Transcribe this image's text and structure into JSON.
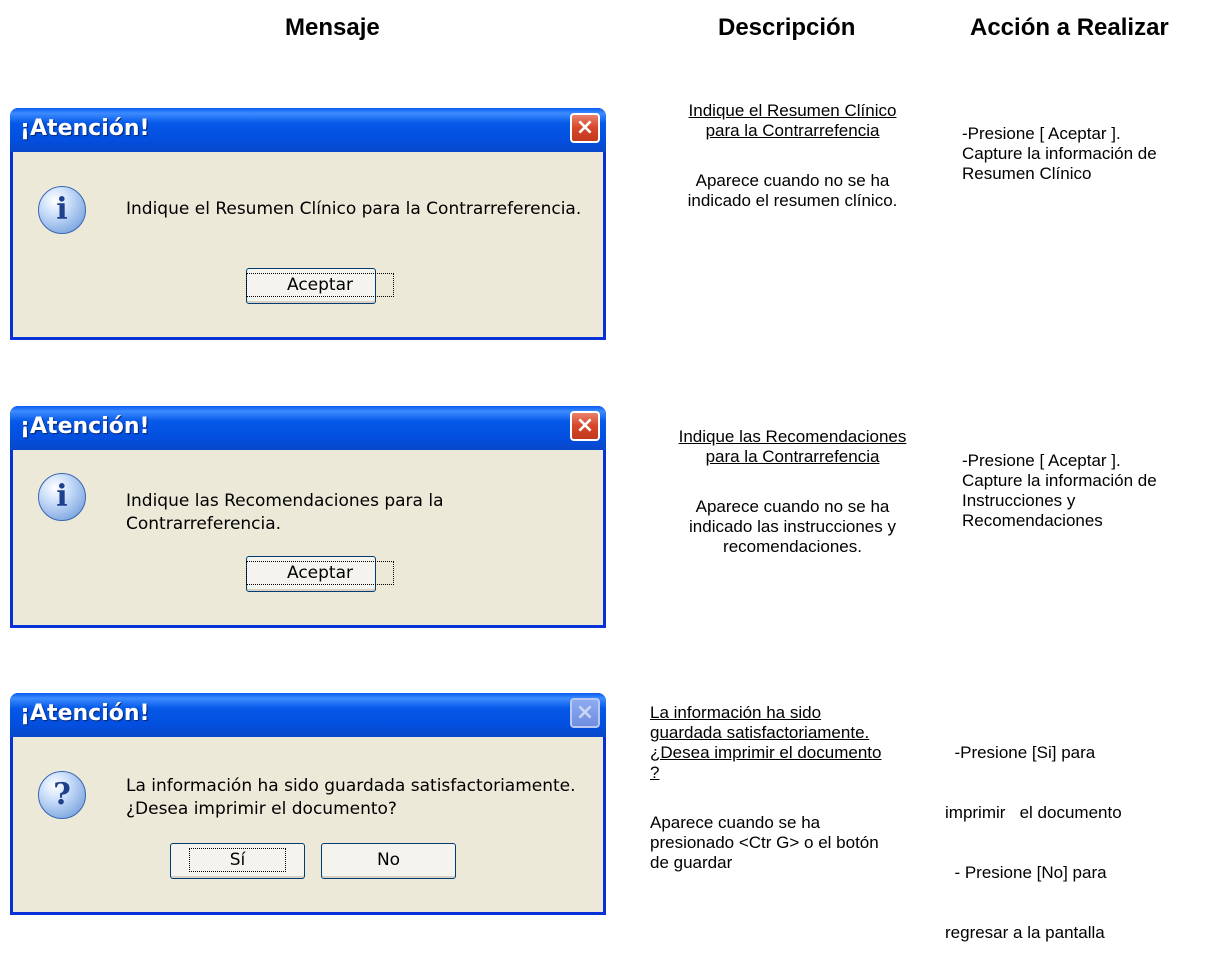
{
  "headers": {
    "mensaje": "Mensaje",
    "descripcion": "Descripción",
    "accion": "Acción a Realizar"
  },
  "rows": [
    {
      "dialog": {
        "title": "¡Atención!",
        "icon": "info-icon",
        "message_lines": [
          "Indique el Resumen Clínico para la Contrarreferencia."
        ],
        "buttons": [
          "Aceptar"
        ]
      },
      "desc_title": [
        "Indique el Resumen Clínico",
        "para la Contrarrefencia"
      ],
      "desc_body": [
        "Aparece cuando no se ha",
        "indicado el resumen clínico."
      ],
      "action": [
        "-Presione [ Aceptar ].",
        "Capture la información de",
        "Resumen Clínico"
      ]
    },
    {
      "dialog": {
        "title": "¡Atención!",
        "icon": "info-icon",
        "message_lines": [
          "Indique las Recomendaciones para la Contrarreferencia."
        ],
        "buttons": [
          "Aceptar"
        ]
      },
      "desc_title": [
        "Indique las Recomendaciones",
        "para la Contrarrefencia"
      ],
      "desc_body": [
        "Aparece cuando no se ha",
        "indicado las instrucciones y",
        "recomendaciones."
      ],
      "action": [
        "-Presione [ Aceptar ].",
        "Capture la información de",
        "Instrucciones y",
        "Recomendaciones"
      ]
    },
    {
      "dialog": {
        "title": "¡Atención!",
        "icon": "question-icon",
        "message_lines": [
          "La información ha sido guardada satisfactoriamente.",
          "¿Desea imprimir el documento?"
        ],
        "buttons": [
          "Sí",
          "No"
        ]
      },
      "desc_title": [
        "La información ha sido",
        "guardada satisfactoriamente.",
        "¿Desea imprimir el documento",
        "?"
      ],
      "desc_body": [
        "Aparece cuando se ha",
        "presionado <Ctr G>  o el botón",
        "de guardar"
      ],
      "action": [
        "  -Presione [Si] para",
        "imprimir   el documento",
        "  - Presione [No] para",
        "regresar a la pantalla"
      ]
    }
  ],
  "icons": {
    "close": "×",
    "info": "i",
    "question": "?"
  }
}
